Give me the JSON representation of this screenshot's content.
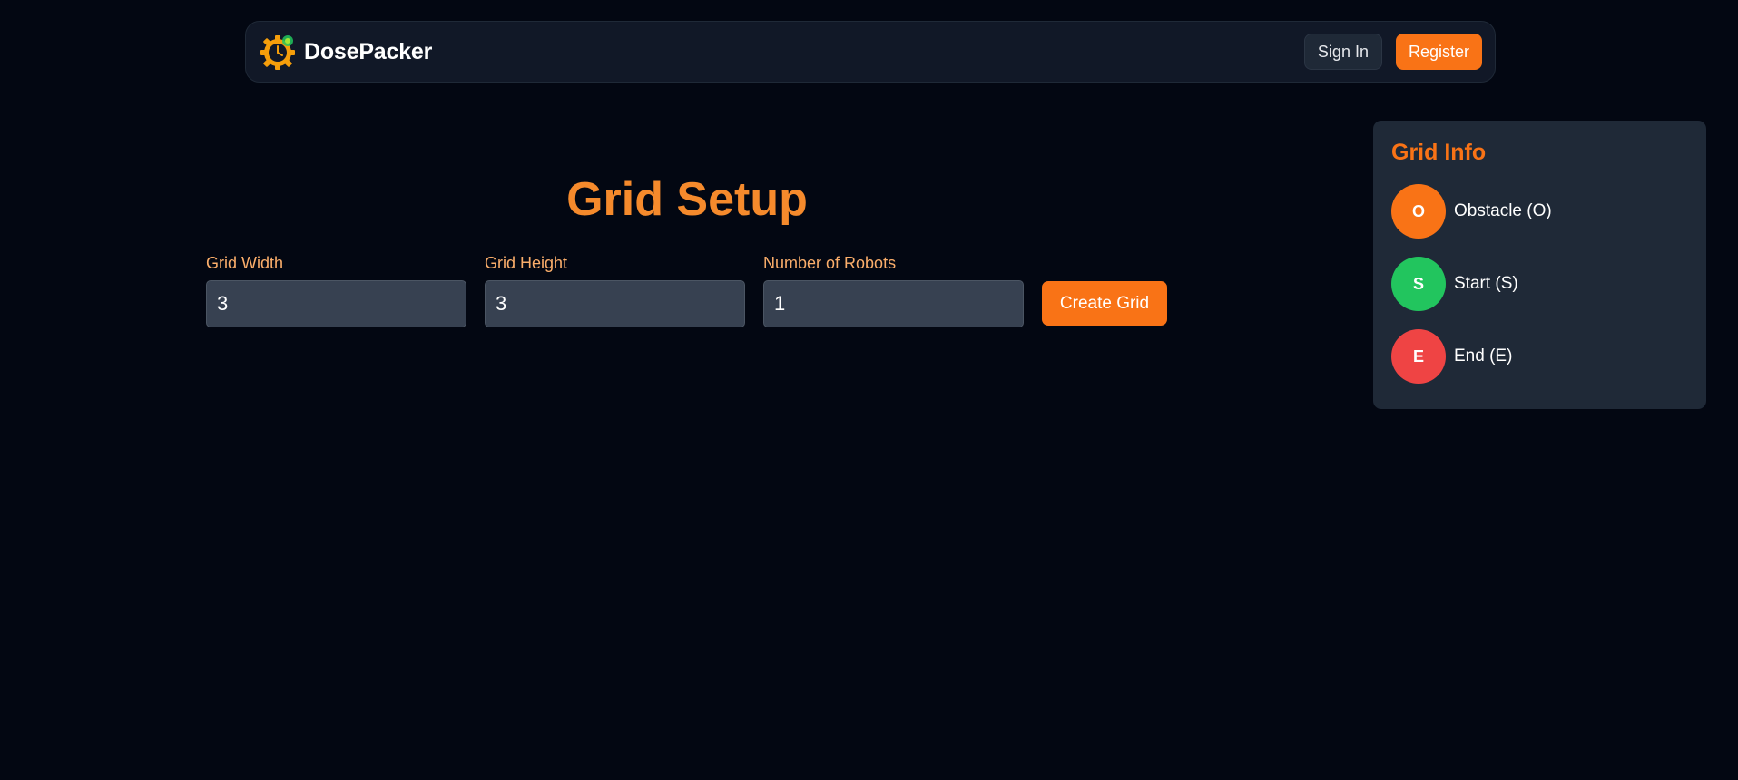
{
  "navbar": {
    "brand": "DosePacker",
    "sign_in_label": "Sign In",
    "register_label": "Register"
  },
  "main": {
    "title": "Grid Setup",
    "fields": [
      {
        "label": "Grid Width",
        "value": "3"
      },
      {
        "label": "Grid Height",
        "value": "3"
      },
      {
        "label": "Number of Robots",
        "value": "1"
      }
    ],
    "create_label": "Create Grid"
  },
  "grid_info": {
    "title": "Grid Info",
    "items": [
      {
        "badge": "O",
        "label": "Obstacle (O)",
        "color": "#f97316"
      },
      {
        "badge": "S",
        "label": "Start (S)",
        "color": "#22c55e"
      },
      {
        "badge": "E",
        "label": "End (E)",
        "color": "#ef4444"
      }
    ]
  },
  "colors": {
    "background": "#030712",
    "accent": "#f97316",
    "panel": "#1f2937"
  },
  "icons": {
    "logo": "gear-clock-logo-icon"
  }
}
